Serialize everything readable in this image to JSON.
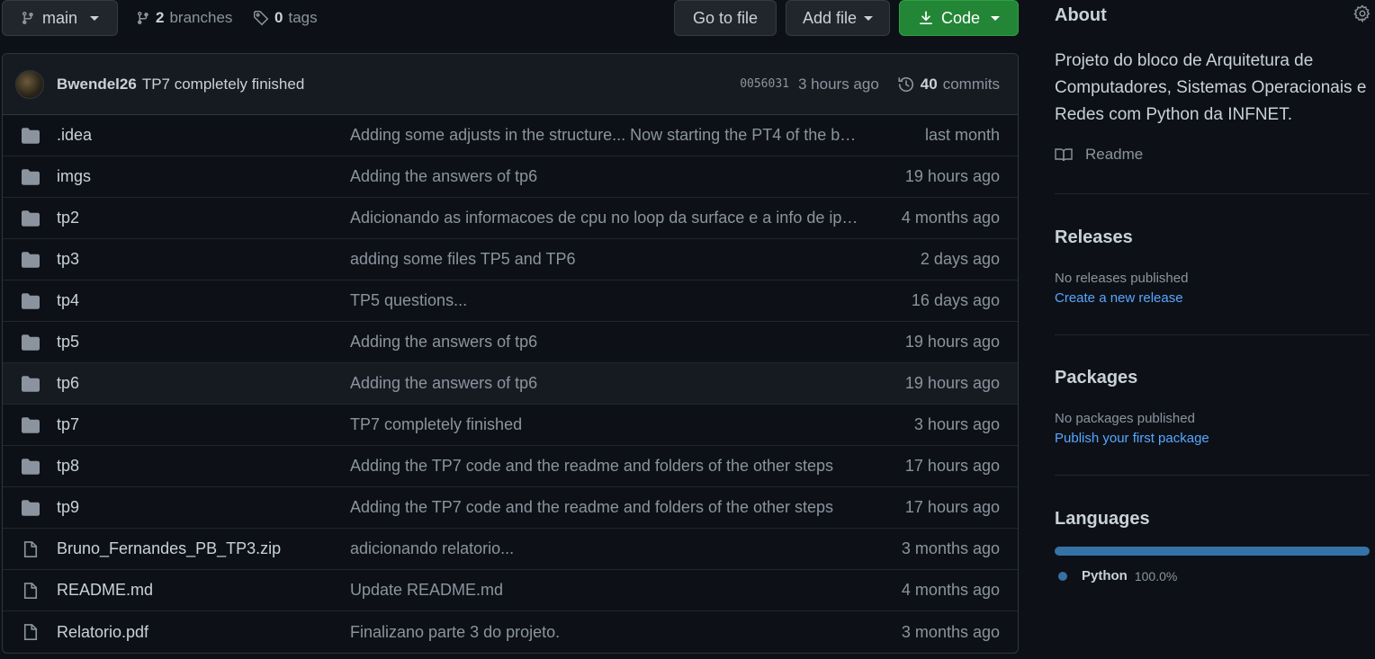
{
  "toolbar": {
    "branch": "main",
    "branches_count": "2",
    "branches_label": "branches",
    "tags_count": "0",
    "tags_label": "tags",
    "goto_label": "Go to file",
    "addfile_label": "Add file",
    "code_label": "Code"
  },
  "commit": {
    "author": "Bwendel26",
    "message": "TP7 completely finished",
    "sha": "0056031",
    "ago": "3 hours ago",
    "commits_count": "40",
    "commits_label": "commits"
  },
  "files": [
    {
      "type": "folder",
      "name": ".idea",
      "message": "Adding some adjusts in the structure... Now starting the PT4 of the b…",
      "date": "last month"
    },
    {
      "type": "folder",
      "name": "imgs",
      "message": "Adding the answers of tp6",
      "date": "19 hours ago"
    },
    {
      "type": "folder",
      "name": "tp2",
      "message": "Adicionando as informacoes de cpu no loop da surface e a info de ip(e…",
      "date": "4 months ago"
    },
    {
      "type": "folder",
      "name": "tp3",
      "message": "adding some files TP5 and TP6",
      "date": "2 days ago"
    },
    {
      "type": "folder",
      "name": "tp4",
      "message": "TP5 questions...",
      "date": "16 days ago"
    },
    {
      "type": "folder",
      "name": "tp5",
      "message": "Adding the answers of tp6",
      "date": "19 hours ago"
    },
    {
      "type": "folder",
      "name": "tp6",
      "message": "Adding the answers of tp6",
      "date": "19 hours ago"
    },
    {
      "type": "folder",
      "name": "tp7",
      "message": "TP7 completely finished",
      "date": "3 hours ago"
    },
    {
      "type": "folder",
      "name": "tp8",
      "message": "Adding the TP7 code and the readme and folders of the other steps",
      "date": "17 hours ago"
    },
    {
      "type": "folder",
      "name": "tp9",
      "message": "Adding the TP7 code and the readme and folders of the other steps",
      "date": "17 hours ago"
    },
    {
      "type": "file",
      "name": "Bruno_Fernandes_PB_TP3.zip",
      "message": "adicionando relatorio...",
      "date": "3 months ago"
    },
    {
      "type": "file",
      "name": "README.md",
      "message": "Update README.md",
      "date": "4 months ago"
    },
    {
      "type": "file",
      "name": "Relatorio.pdf",
      "message": "Finalizano parte 3 do projeto.",
      "date": "3 months ago"
    }
  ],
  "sidebar": {
    "about_title": "About",
    "about_desc": "Projeto do bloco de Arquitetura de Computadores, Sistemas Operacionais e Redes com Python da INFNET.",
    "readme_label": "Readme",
    "releases_title": "Releases",
    "releases_empty": "No releases published",
    "releases_link": "Create a new release",
    "packages_title": "Packages",
    "packages_empty": "No packages published",
    "packages_link": "Publish your first package",
    "languages_title": "Languages",
    "languages": [
      {
        "name": "Python",
        "percent": "100.0%",
        "color": "#3572A5"
      }
    ]
  },
  "colors": {
    "background": "#0d1117",
    "code_button": "#238636",
    "link": "#58a6ff",
    "python": "#3572A5"
  }
}
